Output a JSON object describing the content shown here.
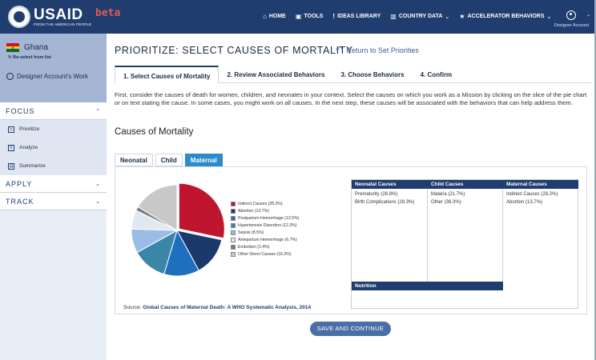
{
  "header": {
    "brand": "USAID",
    "brand_sub": "FROM THE AMERICAN PEOPLE",
    "beta": "beta",
    "nav": [
      {
        "icon": "home-icon",
        "glyph": "⌂",
        "label": "HOME"
      },
      {
        "icon": "lock-icon",
        "glyph": "🔒",
        "label": "TOOLS"
      },
      {
        "icon": "lightbulb-icon",
        "glyph": "!",
        "label": "IDEAS LIBRARY"
      },
      {
        "icon": "chart-icon",
        "glyph": "▥",
        "label": "COUNTRY DATA"
      },
      {
        "icon": "star-icon",
        "glyph": "★",
        "label": "ACCELERATOR BEHAVIORS"
      }
    ],
    "account_label": "Designer Account"
  },
  "sidebar": {
    "country": "Ghana",
    "reselect": "Re-select from list",
    "designer_work": "Designer Account's Work",
    "focus": "FOCUS",
    "items": [
      {
        "icon": "list-icon",
        "label": "Prioritize"
      },
      {
        "icon": "magnifier-person-icon",
        "label": "Analyze"
      },
      {
        "icon": "summary-icon",
        "label": "Summarize"
      }
    ],
    "apply": "APPLY",
    "track": "TRACK"
  },
  "main": {
    "title": "PRIORITIZE: SELECT CAUSES OF MORTALITY",
    "return_label": "Return to Set Priorities",
    "steps": [
      "1. Select Causes of Mortality",
      "2. Review Associated Behaviors",
      "3. Choose Behaviors",
      "4. Confirm"
    ],
    "intro": "First, consider the causes of death for women, children, and neonates in your context. Select the causes on which you work as a Mission by clicking on the slice of the pie chart or on text stating the cause. In some cases, you might work on all causes. In the next step, these causes will be associated with the behaviors that can help address them.",
    "section_title": "Causes of Mortality",
    "cause_tabs": [
      "Neonatal",
      "Child",
      "Maternal"
    ],
    "source_prefix": "Source:",
    "source_link": "Global Causes of Maternal Death: A WHO Systematic Analysis, 2014",
    "save_label": "SAVE AND CONTINUE"
  },
  "chart_data": {
    "type": "pie",
    "title": "",
    "slices": [
      {
        "label": "Indirect Causes (28.2%)",
        "value": 28.2,
        "color": "#c0152f"
      },
      {
        "label": "Abortion (13.7%)",
        "value": 13.7,
        "color": "#1b3a6b"
      },
      {
        "label": "Postpartum Hemorrhage (12.5%)",
        "value": 12.5,
        "color": "#1f6fbf"
      },
      {
        "label": "Hypertensive Disorders (12.3%)",
        "value": 12.3,
        "color": "#3a85a8"
      },
      {
        "label": "Sepsis (8.5%)",
        "value": 8.5,
        "color": "#9bbde5"
      },
      {
        "label": "Antepartum Hemorrhage (6.7%)",
        "value": 6.7,
        "color": "#e2e8f2"
      },
      {
        "label": "Embolism (1.4%)",
        "value": 1.4,
        "color": "#7a7a7a"
      },
      {
        "label": "Other Direct Causes (16.3%)",
        "value": 16.3,
        "color": "#c8c8c8"
      }
    ]
  },
  "selected": {
    "neonatal_header": "Neonatal Causes",
    "child_header": "Child Causes",
    "maternal_header": "Maternal Causes",
    "nutrition_header": "Nutrition",
    "neonatal": [
      "Prematurity (28.8%)",
      "Birth Complications (28.3%)"
    ],
    "child": [
      "Malaria (21.7%)",
      "Other (36.3%)"
    ],
    "maternal": [
      "Indirect Causes (28.2%)",
      "Abortion (13.7%)"
    ]
  },
  "colors": {
    "navbar": "#1f3d6e",
    "accent": "#2d8bc9",
    "beta": "#e05a5a"
  }
}
